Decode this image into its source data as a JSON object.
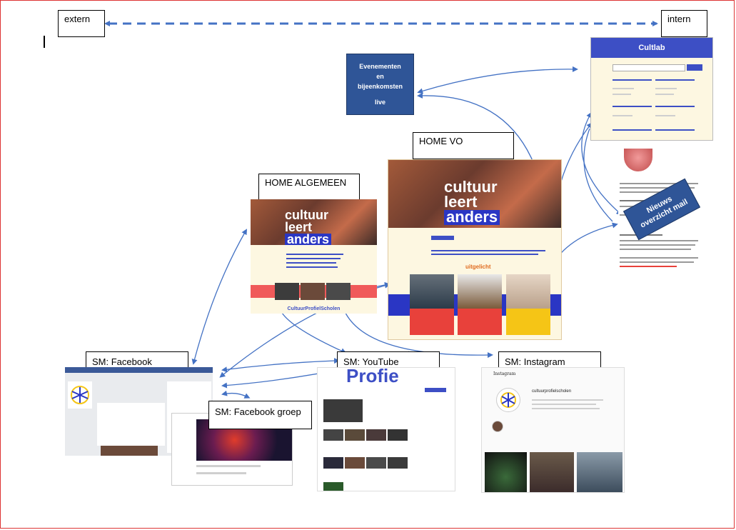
{
  "labels": {
    "extern": "extern",
    "intern": "intern",
    "home_algemeen": "HOME ALGEMEEN",
    "home_vo": "HOME VO",
    "sm_facebook": "SM: Facebook",
    "sm_youtube": "SM: YouTube",
    "sm_instagram": "SM: Instagram",
    "sm_facebook_groep": "SM: Facebook groep"
  },
  "events_box": {
    "line1": "Evenementen",
    "line2": "en",
    "line3": "bijeenkomsten",
    "line4": "live"
  },
  "news_box": {
    "line1": "Nieuws",
    "line2": "overzicht mail"
  },
  "cultlab": {
    "title": "Cultlab"
  },
  "home_algemeen_site": {
    "hero_line1": "cultuur",
    "hero_line2": "leert",
    "hero_line3": "anders",
    "footer": "CultuurProfielScholen"
  },
  "home_vo_site": {
    "hero_line1": "cultuur",
    "hero_line2": "leert",
    "hero_line3": "anders",
    "section": "uitgelicht"
  },
  "youtube_banner": "Profie",
  "instagram": {
    "logo": "Instagram",
    "username": "cultuurprofielscholen"
  },
  "colors": {
    "frame_border": "#dd3333",
    "arrow_blue": "#4472c4",
    "box_blue": "#2f5597",
    "hero_blue": "#2a36c4",
    "accent_red": "#e8413b",
    "cream": "#fdf7e1"
  }
}
